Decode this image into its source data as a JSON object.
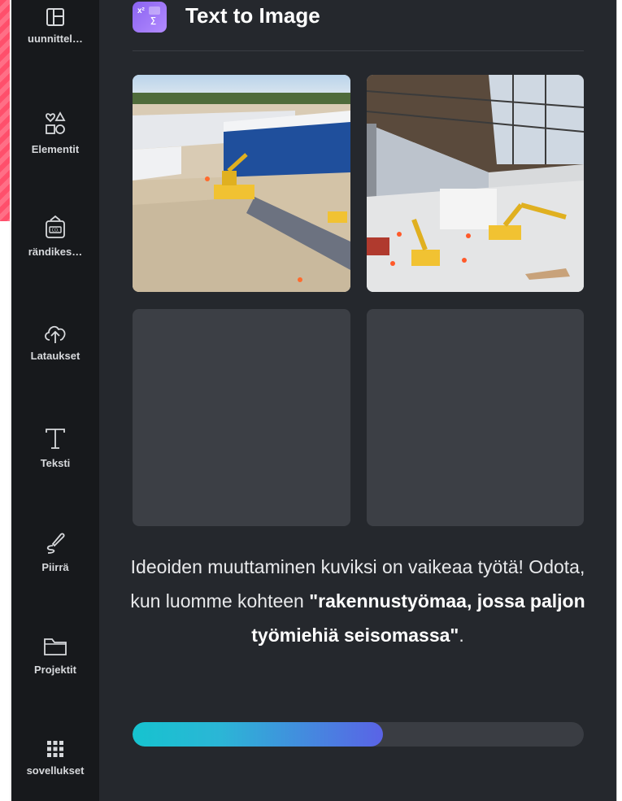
{
  "sidebar": {
    "items": [
      {
        "label": "uunnittel…",
        "icon": "layout-icon"
      },
      {
        "label": "Elementit",
        "icon": "shapes-icon"
      },
      {
        "label": "rändikes…",
        "icon": "brand-kit-icon"
      },
      {
        "label": "Lataukset",
        "icon": "cloud-upload-icon"
      },
      {
        "label": "Teksti",
        "icon": "text-icon"
      },
      {
        "label": "Piirrä",
        "icon": "draw-icon"
      },
      {
        "label": "Projektit",
        "icon": "folder-icon"
      },
      {
        "label": "sovellukset",
        "icon": "apps-grid-icon"
      }
    ]
  },
  "panel": {
    "title": "Text to Image",
    "message_before": "Ideoiden muuttaminen kuviksi on vaikeaa työtä! Odota, kun luomme kohteen ",
    "message_query": "\"rakennustyömaa, jossa paljon työmiehiä seisomassa\"",
    "message_after": ".",
    "progress_fraction": 0.555
  },
  "colors": {
    "sidebar_bg": "#17191c",
    "panel_bg": "#25282d",
    "placeholder_bg": "#3c3f45",
    "progress_start": "#16c3cf",
    "progress_end": "#5a63e6",
    "brand_stripe": "#ff4f6b"
  }
}
